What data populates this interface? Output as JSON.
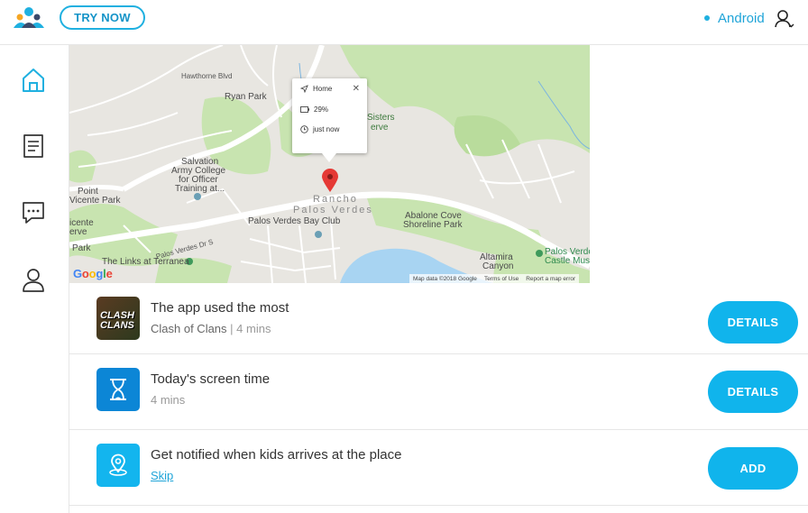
{
  "header": {
    "try_label": "TRY NOW",
    "device_name": "Android"
  },
  "sidebar": {
    "items": [
      {
        "icon": "home-icon",
        "active": true
      },
      {
        "icon": "document-icon",
        "active": false
      },
      {
        "icon": "chat-icon",
        "active": false
      },
      {
        "icon": "profile-icon",
        "active": false
      }
    ]
  },
  "map": {
    "popup": {
      "place": "Home",
      "battery": "29%",
      "updated": "just now",
      "close_glyph": "✕"
    },
    "labels": {
      "hawthorne_blvd": "Hawthorne Blvd",
      "ryan_park": "Ryan Park",
      "sisters": "Sisters",
      "reserve": "erve",
      "salvation": "Salvation",
      "army_college": "Army College",
      "for_officer": "for Officer",
      "training_at": "Training at...",
      "point": "Point",
      "vicente_park": "Vicente Park",
      "icente": "icente",
      "erve2": "erve",
      "park": "Park",
      "rancho": "Rancho",
      "palos_verdes_town": "Palos Verdes",
      "bay_club": "Palos Verdes Bay Club",
      "palos_verdes_dr_s": "Palos Verdes Dr S",
      "abalone": "Abalone Cove",
      "shoreline": "Shoreline Park",
      "links": "The Links at Terranea",
      "altamira": "Altamira",
      "canyon": "Canyon",
      "castle1": "Palos Verde",
      "castle2": "Castle Muse"
    },
    "logo": "Google",
    "attribution": [
      "Map data ©2018 Google",
      "Terms of Use",
      "Report a map error"
    ]
  },
  "cards": [
    {
      "title": "The app used the most",
      "subtitle_main": "Clash of Clans",
      "separator": " | ",
      "subtitle_muted": "4 mins",
      "thumb_text": "CLASH\nCLANS",
      "action": "DETAILS"
    },
    {
      "title": "Today's screen time",
      "subtitle_muted": "4 mins",
      "action": "DETAILS"
    },
    {
      "title": "Get notified when kids arrives at the place",
      "link": "Skip",
      "action": "ADD"
    }
  ],
  "colors": {
    "accent": "#10b4ec",
    "accent_dark": "#1594c8",
    "park_green": "#c8e4b0",
    "water": "#a8d4f2",
    "pin": "#e53935"
  }
}
